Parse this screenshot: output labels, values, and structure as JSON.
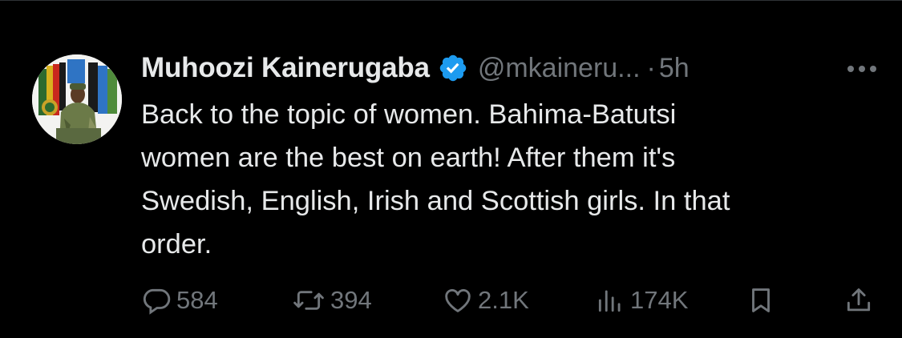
{
  "tweet": {
    "display_name": "Muhoozi Kainerugaba",
    "handle": "@mkaineru...",
    "separator": "·",
    "time": "5h",
    "text_lines": [
      "Back to the topic of women. Bahima-Batutsi",
      "women are the best on earth! After them it's",
      "Swedish, English, Irish and Scottish girls. In that",
      "order."
    ],
    "verified": true,
    "avatar_icon": "profile-photo"
  },
  "actions": {
    "replies": "584",
    "reposts": "394",
    "likes": "2.1K",
    "views": "174K"
  },
  "colors": {
    "background": "#000000",
    "primary_text": "#e7e9ea",
    "secondary_text": "#71767b",
    "verified_badge": "#1d9bf0",
    "divider": "#2f3336"
  },
  "icons": [
    "reply-icon",
    "repost-icon",
    "like-icon",
    "views-icon",
    "bookmark-icon",
    "share-icon",
    "more-icon",
    "verified-badge-icon"
  ]
}
